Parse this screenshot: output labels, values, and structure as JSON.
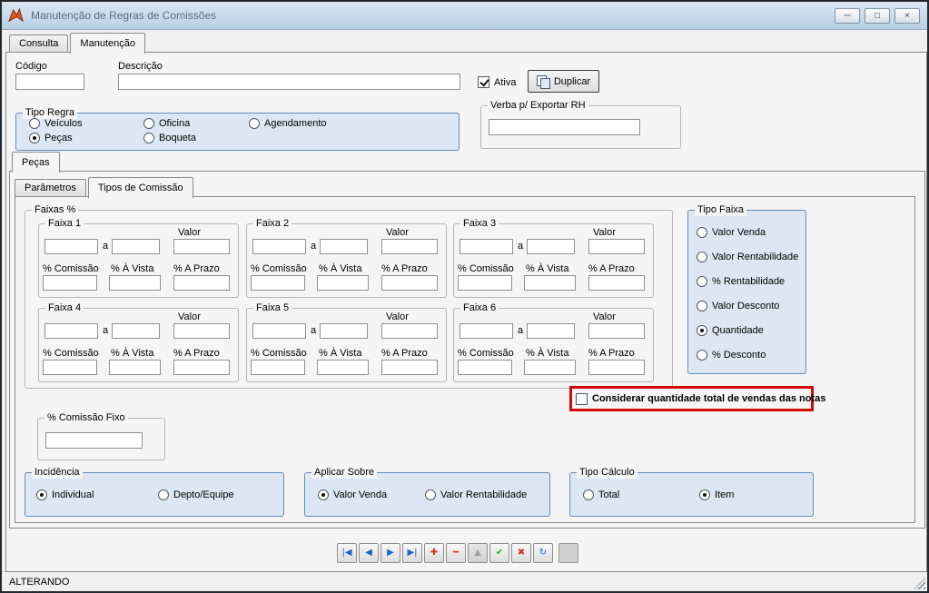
{
  "window": {
    "title": "Manutenção de Regras de Comissões",
    "status_text": "ALTERANDO",
    "controls": {
      "minimize": "─",
      "maximize": "□",
      "close": "×"
    }
  },
  "main_tabs": {
    "consulta": "Consulta",
    "manutencao": "Manutenção"
  },
  "header": {
    "codigo_label": "Código",
    "descricao_label": "Descrição",
    "ativa": {
      "label": "Ativa",
      "checked": true
    },
    "duplicar_label": "Duplicar"
  },
  "tipo_regra": {
    "title": "Tipo Regra",
    "options": [
      {
        "label": "Veículos",
        "selected": false
      },
      {
        "label": "Oficina",
        "selected": false
      },
      {
        "label": "Agendamento",
        "selected": false
      },
      {
        "label": "Peças",
        "selected": true
      },
      {
        "label": "Boqueta",
        "selected": false
      }
    ]
  },
  "verba_rh": {
    "title": "Verba p/ Exportar RH",
    "value": ""
  },
  "pecas_tab_label": "Peças",
  "inner_tabs": {
    "parametros": "Parâmetros",
    "tipos_comissao": "Tipos de Comissão"
  },
  "faixas": {
    "title": "Faixas %",
    "labels": {
      "a": "a",
      "valor": "Valor",
      "comissao": "% Comissão",
      "a_vista": "% À Vista",
      "a_prazo": "% A Prazo"
    },
    "groups": [
      {
        "label": "Faixa 1"
      },
      {
        "label": "Faixa 2"
      },
      {
        "label": "Faixa 3"
      },
      {
        "label": "Faixa 4"
      },
      {
        "label": "Faixa 5"
      },
      {
        "label": "Faixa 6"
      }
    ]
  },
  "tipo_faixa": {
    "title": "Tipo Faixa",
    "options": [
      {
        "label": "Valor Venda",
        "selected": false
      },
      {
        "label": "Valor Rentabilidade",
        "selected": false
      },
      {
        "label": "% Rentabilidade",
        "selected": false
      },
      {
        "label": "Valor Desconto",
        "selected": false
      },
      {
        "label": "Quantidade",
        "selected": true
      },
      {
        "label": "% Desconto",
        "selected": false
      }
    ]
  },
  "considerar": {
    "label": "Considerar quantidade total de vendas das notas",
    "checked": false
  },
  "comissao_fixo": {
    "title": "% Comissão Fixo",
    "value": ""
  },
  "incidencia": {
    "title": "Incidência",
    "options": [
      {
        "label": "Individual",
        "selected": true
      },
      {
        "label": "Depto/Equipe",
        "selected": false
      }
    ]
  },
  "aplicar_sobre": {
    "title": "Aplicar Sobre",
    "options": [
      {
        "label": "Valor Venda",
        "selected": true
      },
      {
        "label": "Valor Rentabilidade",
        "selected": false
      }
    ]
  },
  "tipo_calculo": {
    "title": "Tipo Cálculo",
    "options": [
      {
        "label": "Total",
        "selected": false
      },
      {
        "label": "Item",
        "selected": true
      }
    ]
  },
  "nav": {
    "buttons": [
      {
        "name": "first-record",
        "glyph": "|◀"
      },
      {
        "name": "previous-record",
        "glyph": "◀"
      },
      {
        "name": "next-record",
        "glyph": "▶"
      },
      {
        "name": "last-record",
        "glyph": "▶|"
      },
      {
        "name": "add-record",
        "glyph": "✚"
      },
      {
        "name": "delete-record",
        "glyph": "━"
      },
      {
        "name": "move-up",
        "glyph": "▲"
      },
      {
        "name": "confirm",
        "glyph": "✔"
      },
      {
        "name": "cancel",
        "glyph": "✖"
      },
      {
        "name": "refresh",
        "glyph": "↻"
      }
    ]
  }
}
